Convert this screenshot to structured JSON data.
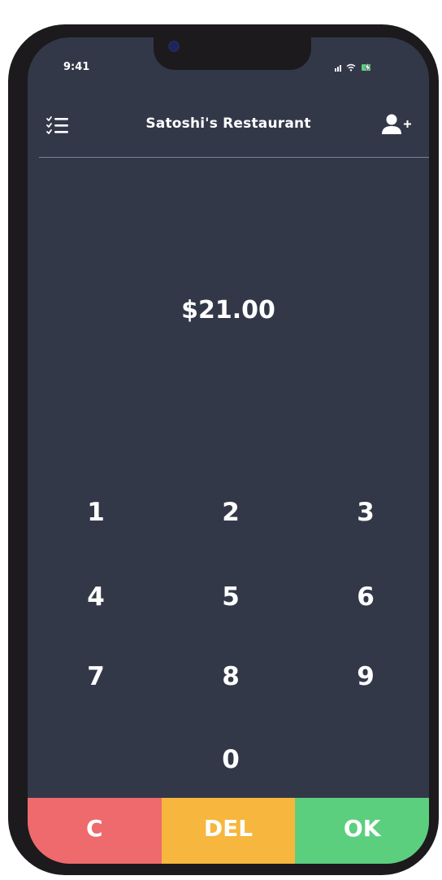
{
  "status_bar": {
    "time": "9:41"
  },
  "header": {
    "title": "Satoshi's Restaurant",
    "menu_icon": "checklist-menu-icon",
    "add_user_icon": "add-user-icon"
  },
  "amount": "$21.00",
  "keypad": {
    "keys": [
      "1",
      "2",
      "3",
      "4",
      "5",
      "6",
      "7",
      "8",
      "9",
      "0"
    ]
  },
  "actions": {
    "clear_label": "C",
    "delete_label": "DEL",
    "ok_label": "OK"
  },
  "colors": {
    "screen_background": "#333849",
    "clear": "#ee6a6c",
    "delete": "#f7b63d",
    "ok": "#5ccf7f",
    "battery": "#5ccf7f"
  }
}
